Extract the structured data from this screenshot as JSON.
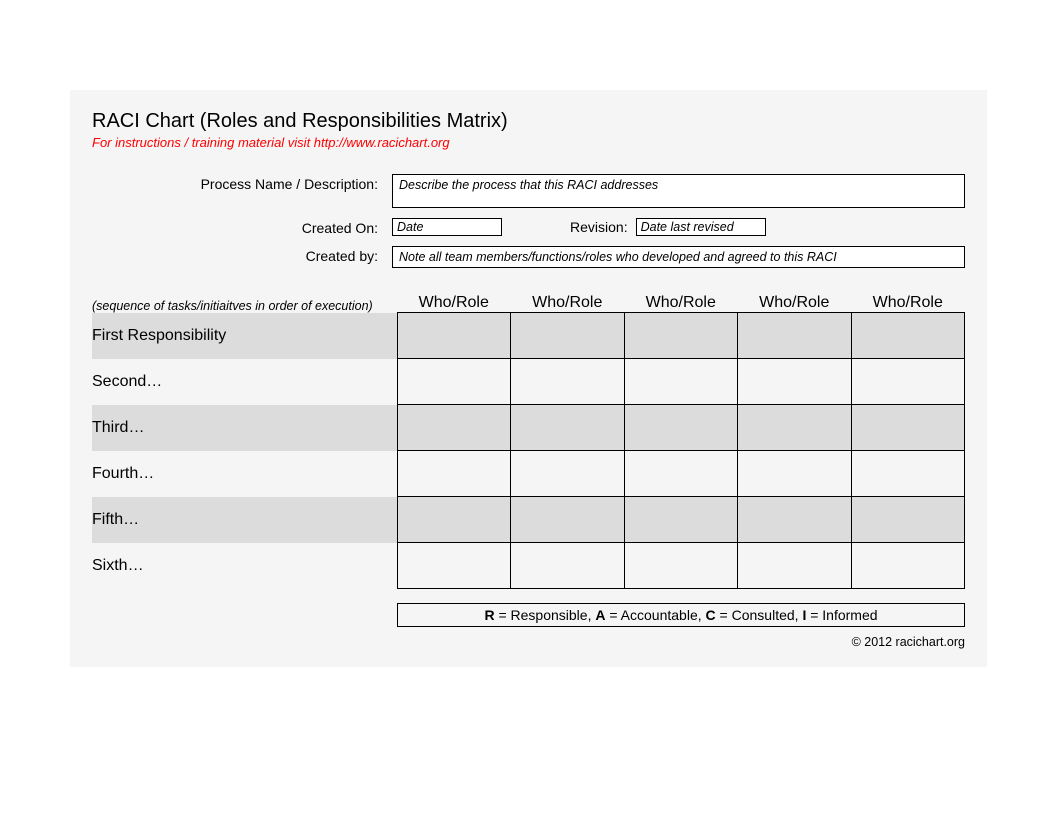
{
  "title": "RACI Chart (Roles and Responsibilities Matrix)",
  "subtitle": "For instructions / training material visit http://www.racichart.org",
  "meta": {
    "process_label": "Process Name / Description:",
    "process_placeholder": "Describe the process that this RACI addresses",
    "created_on_label": "Created On:",
    "created_on_placeholder": "Date",
    "revision_label": "Revision:",
    "revision_placeholder": "Date last revised",
    "created_by_label": "Created by:",
    "created_by_placeholder": "Note all team members/functions/roles who developed and agreed to this RACI"
  },
  "sequence_note": "(sequence of tasks/initiaitves in order of execution)",
  "role_headers": [
    "Who/Role",
    "Who/Role",
    "Who/Role",
    "Who/Role",
    "Who/Role"
  ],
  "tasks": [
    "First Responsibility",
    "Second…",
    "Third…",
    "Fourth…",
    "Fifth…",
    "Sixth…"
  ],
  "legend": {
    "r_code": "R",
    "r_text": " = Responsible,   ",
    "a_code": "A",
    "a_text": " = Accountable,  ",
    "c_code": "C",
    "c_text": " = Consulted,  ",
    "i_code": "I",
    "i_text": " = Informed"
  },
  "footer": "© 2012 racichart.org"
}
